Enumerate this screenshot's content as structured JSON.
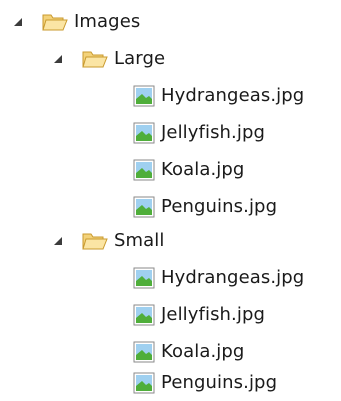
{
  "tree": {
    "root": {
      "label": "Images",
      "icon": "folder-open-icon",
      "expanded": true,
      "children": [
        {
          "label": "Large",
          "icon": "folder-open-icon",
          "expanded": true,
          "files": [
            {
              "label": "Hydrangeas.jpg",
              "icon": "image-file-icon"
            },
            {
              "label": "Jellyfish.jpg",
              "icon": "image-file-icon"
            },
            {
              "label": "Koala.jpg",
              "icon": "image-file-icon"
            },
            {
              "label": "Penguins.jpg",
              "icon": "image-file-icon"
            }
          ]
        },
        {
          "label": "Small",
          "icon": "folder-open-icon",
          "expanded": true,
          "files": [
            {
              "label": "Hydrangeas.jpg",
              "icon": "image-file-icon"
            },
            {
              "label": "Jellyfish.jpg",
              "icon": "image-file-icon"
            },
            {
              "label": "Koala.jpg",
              "icon": "image-file-icon"
            },
            {
              "label": "Penguins.jpg",
              "icon": "image-file-icon"
            }
          ]
        }
      ]
    },
    "colors": {
      "folder_fill": "#f3d27a",
      "folder_stroke": "#c99a2e",
      "expander": "#3c3c3c",
      "image_sky": "#9fd0f0",
      "image_grass": "#4fae3a",
      "image_frame": "#8a8a8a"
    }
  }
}
